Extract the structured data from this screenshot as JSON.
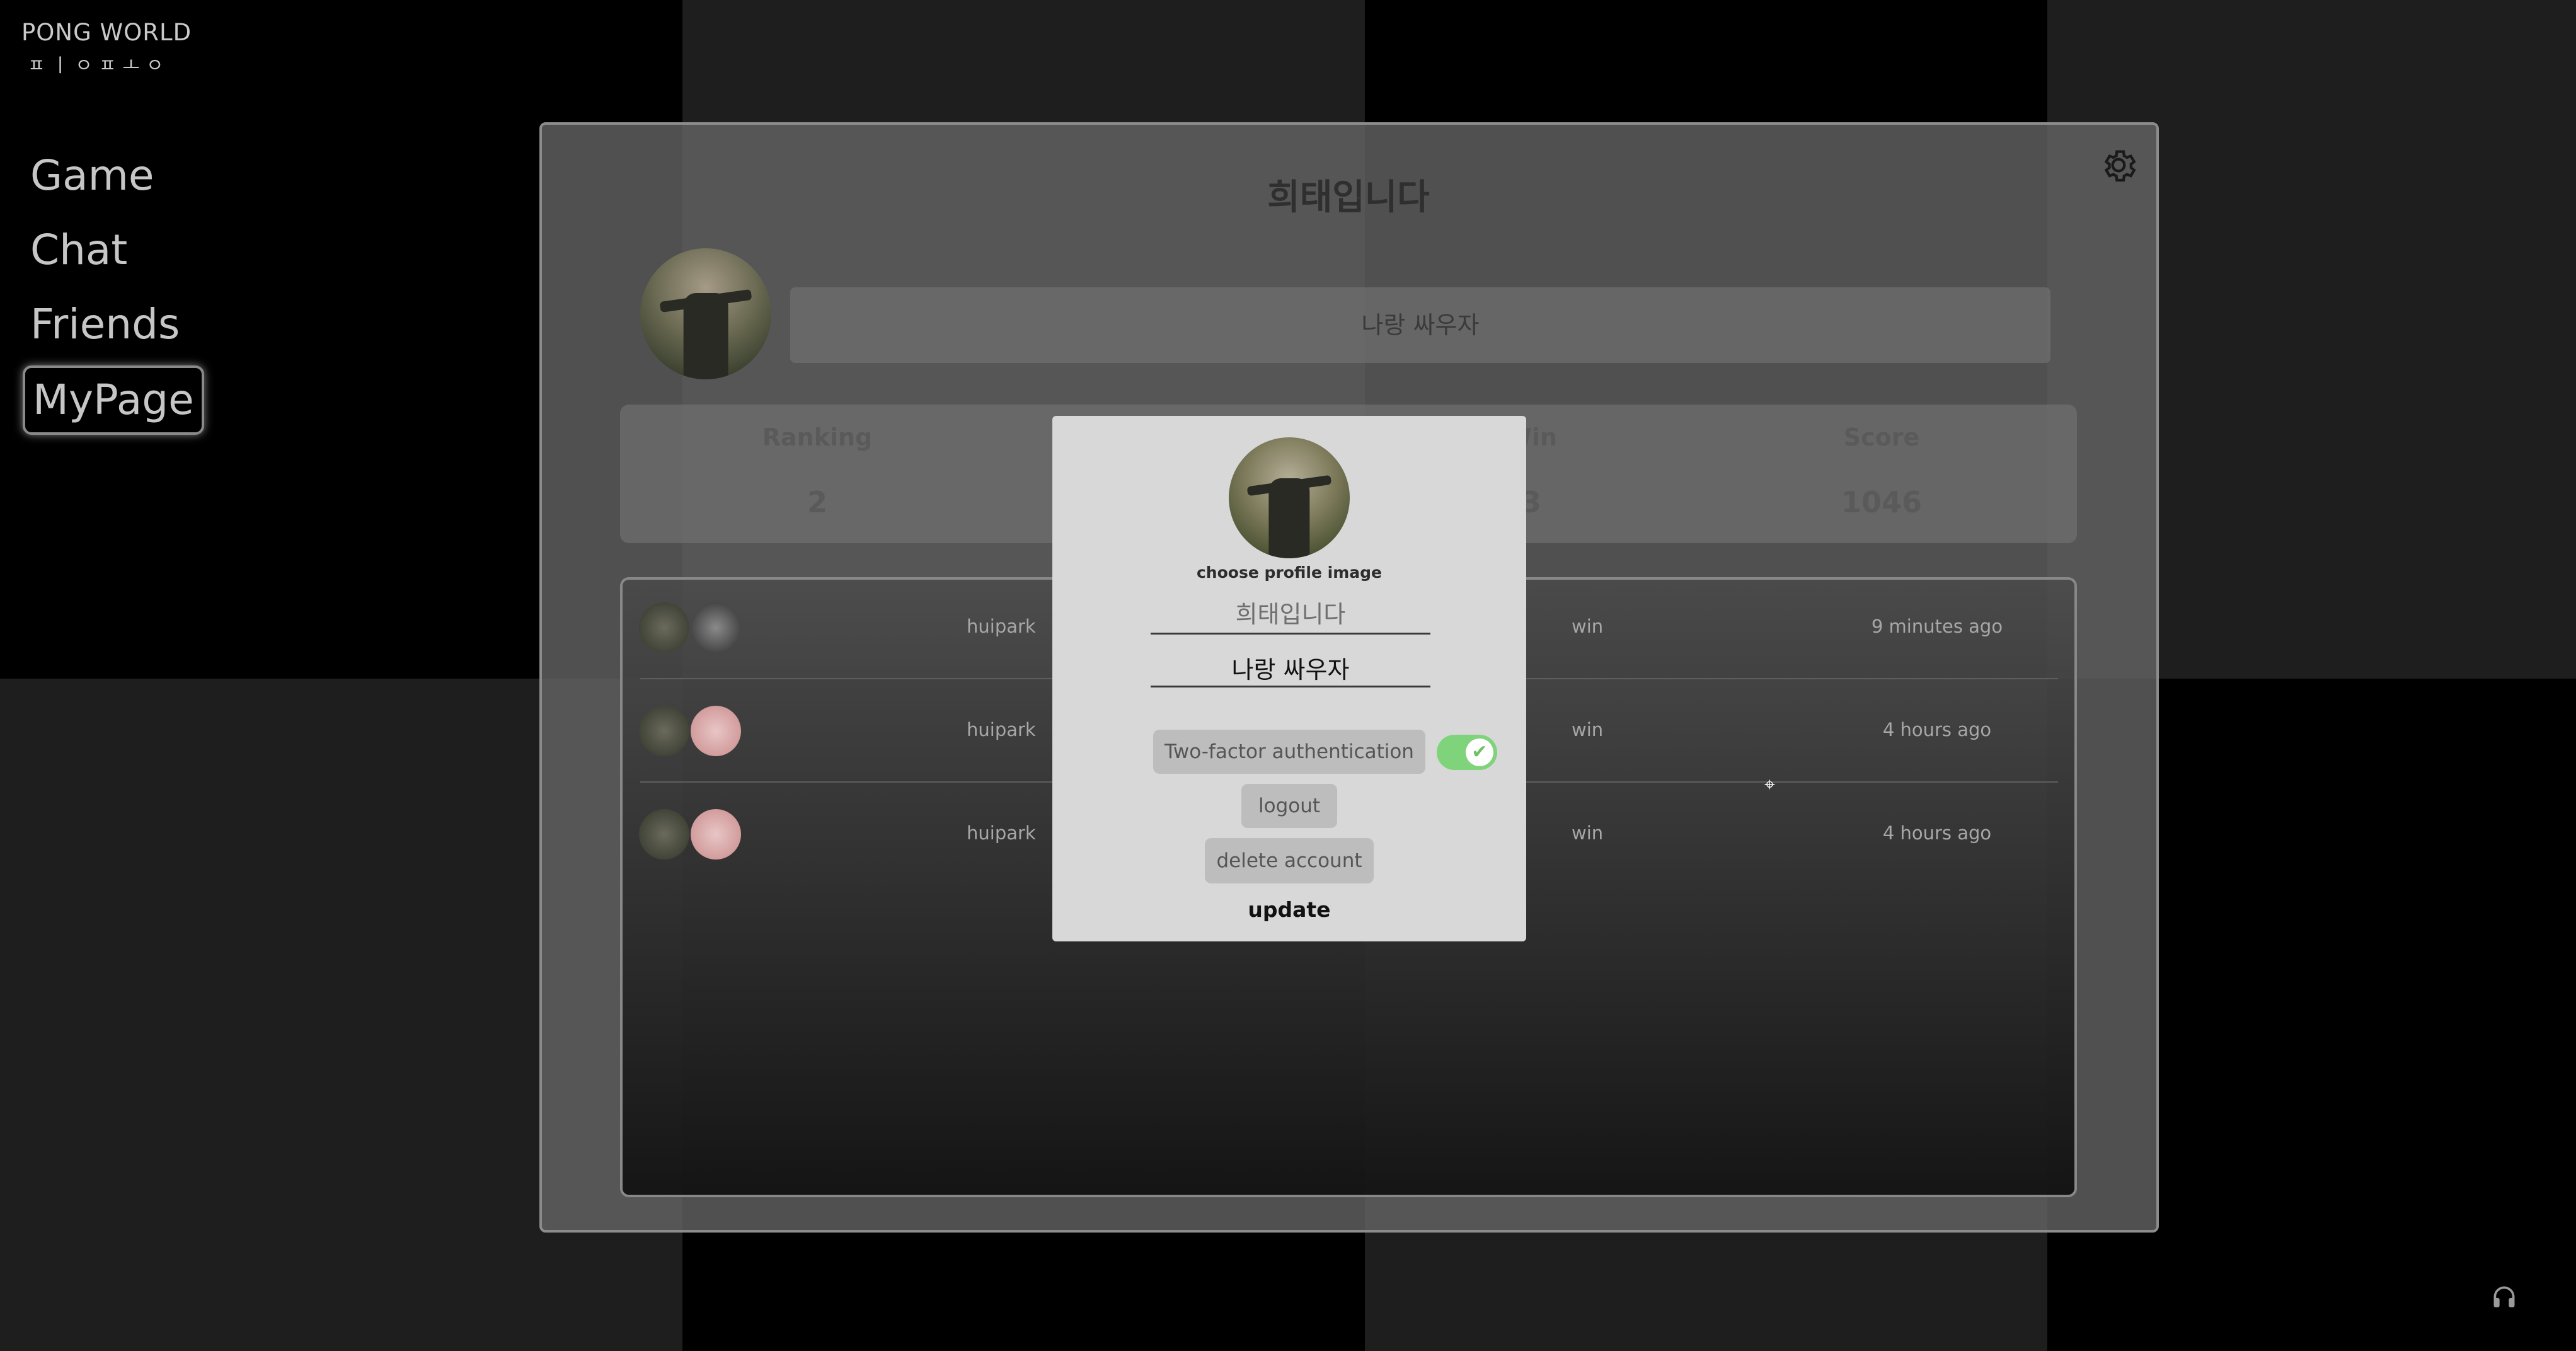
{
  "logo": {
    "title": "PONG WORLD",
    "subtitle": "ㅍㅣㅇㅍㅗㅇ"
  },
  "nav": {
    "items": [
      "Game",
      "Chat",
      "Friends",
      "MyPage"
    ],
    "active": "MyPage"
  },
  "profile": {
    "nickname": "희태입니다",
    "status_message": "나랑 싸우자",
    "stats": [
      {
        "label": "Ranking",
        "value": "2"
      },
      {
        "label": "Win",
        "value": "3"
      },
      {
        "label": "Score",
        "value": "1046"
      }
    ]
  },
  "history": [
    {
      "opponent": "huipark",
      "result": "win",
      "time": "9 minutes ago"
    },
    {
      "opponent": "huipark",
      "result": "win",
      "time": "4 hours ago"
    },
    {
      "opponent": "huipark",
      "result": "win",
      "time": "4 hours ago"
    }
  ],
  "modal": {
    "choose_image": "choose profile image",
    "nickname_placeholder": "희태입니다",
    "status_value": "나랑 싸우자",
    "two_factor_label": "Two-factor authentication",
    "two_factor_enabled": true,
    "logout_label": "logout",
    "delete_label": "delete account",
    "update_label": "update"
  },
  "icons": {
    "settings": "gear-icon",
    "audio": "headphones-icon",
    "check": "check-icon"
  },
  "colors": {
    "toggle_on": "#7fd37a",
    "modal_bg": "#d8d8d8"
  }
}
